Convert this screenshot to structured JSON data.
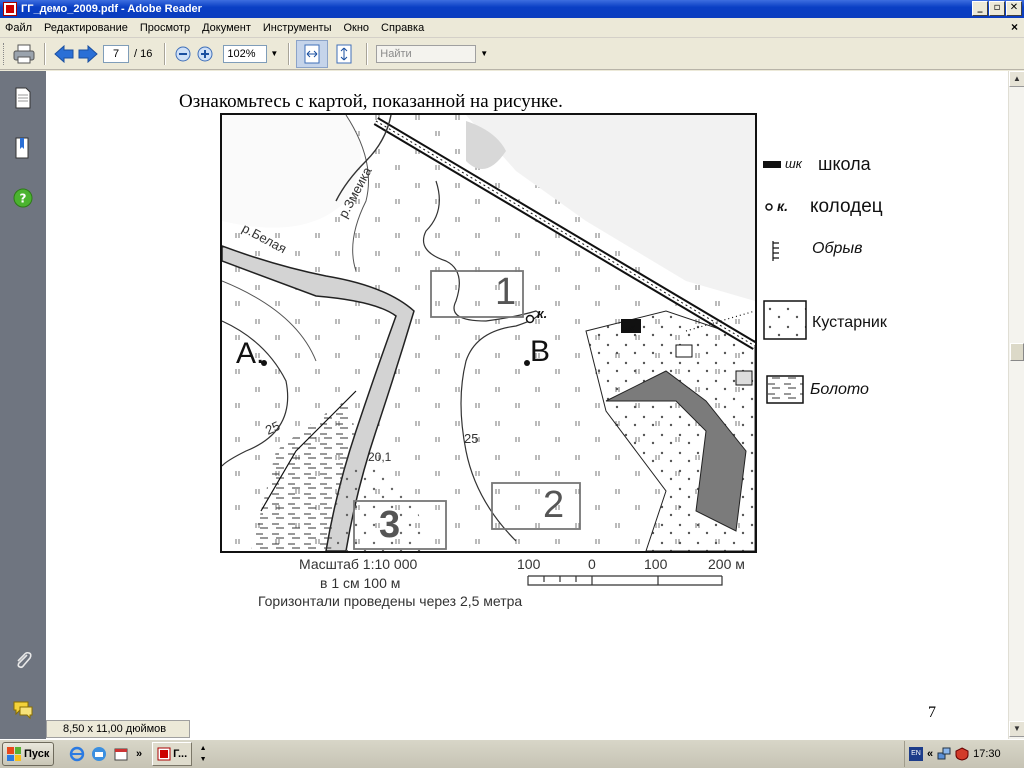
{
  "window": {
    "title": "ГГ_демо_2009.pdf - Adobe Reader",
    "minimize_glyph": "_",
    "maximize_glyph": "▫",
    "close_glyph": "✕",
    "doc_close_glyph": "×"
  },
  "menu": {
    "items": [
      "Файл",
      "Редактирование",
      "Просмотр",
      "Документ",
      "Инструменты",
      "Окно",
      "Справка"
    ]
  },
  "toolbar": {
    "current_page": "7",
    "page_separator": "/ 16",
    "zoom": "102%",
    "find_placeholder": "Найти"
  },
  "document": {
    "heading": "Ознакомьтесь с картой, показанной на рисунке.",
    "page_number": "7",
    "map": {
      "zones": [
        "1",
        "2",
        "3"
      ],
      "points": [
        "A.",
        "B"
      ],
      "river_labels": [
        "р.Белая",
        "р.Змеика"
      ],
      "contour_labels": [
        "25",
        "25",
        "20,1"
      ],
      "well_label": "к.",
      "school_label": "шк",
      "legend": [
        {
          "symbol": "шк",
          "label": "школа"
        },
        {
          "symbol": "к.",
          "label": "колодец"
        },
        {
          "symbol": "",
          "label": "Обрыв"
        },
        {
          "symbol": "",
          "label": "Кустарник"
        },
        {
          "symbol": "",
          "label": "Болото"
        }
      ],
      "scale": {
        "line1": "Масштаб   1:10 000",
        "line2": "в 1 см  100 м",
        "line3": "Горизонтали проведены через 2,5 метра",
        "ticks": [
          "100",
          "0",
          "100",
          "200 м"
        ]
      }
    }
  },
  "statusbar": {
    "page_size": "8,50 x 11,00 дюймов"
  },
  "taskbar": {
    "start_label": "Пуск",
    "task_label": "Г...",
    "lang": "EN",
    "time": "17:30",
    "chevron": "»"
  },
  "colors": {
    "titlebar": "#0a3fc4",
    "sidebar": "#6f7580",
    "accent_arrow": "#2a6fd6"
  }
}
